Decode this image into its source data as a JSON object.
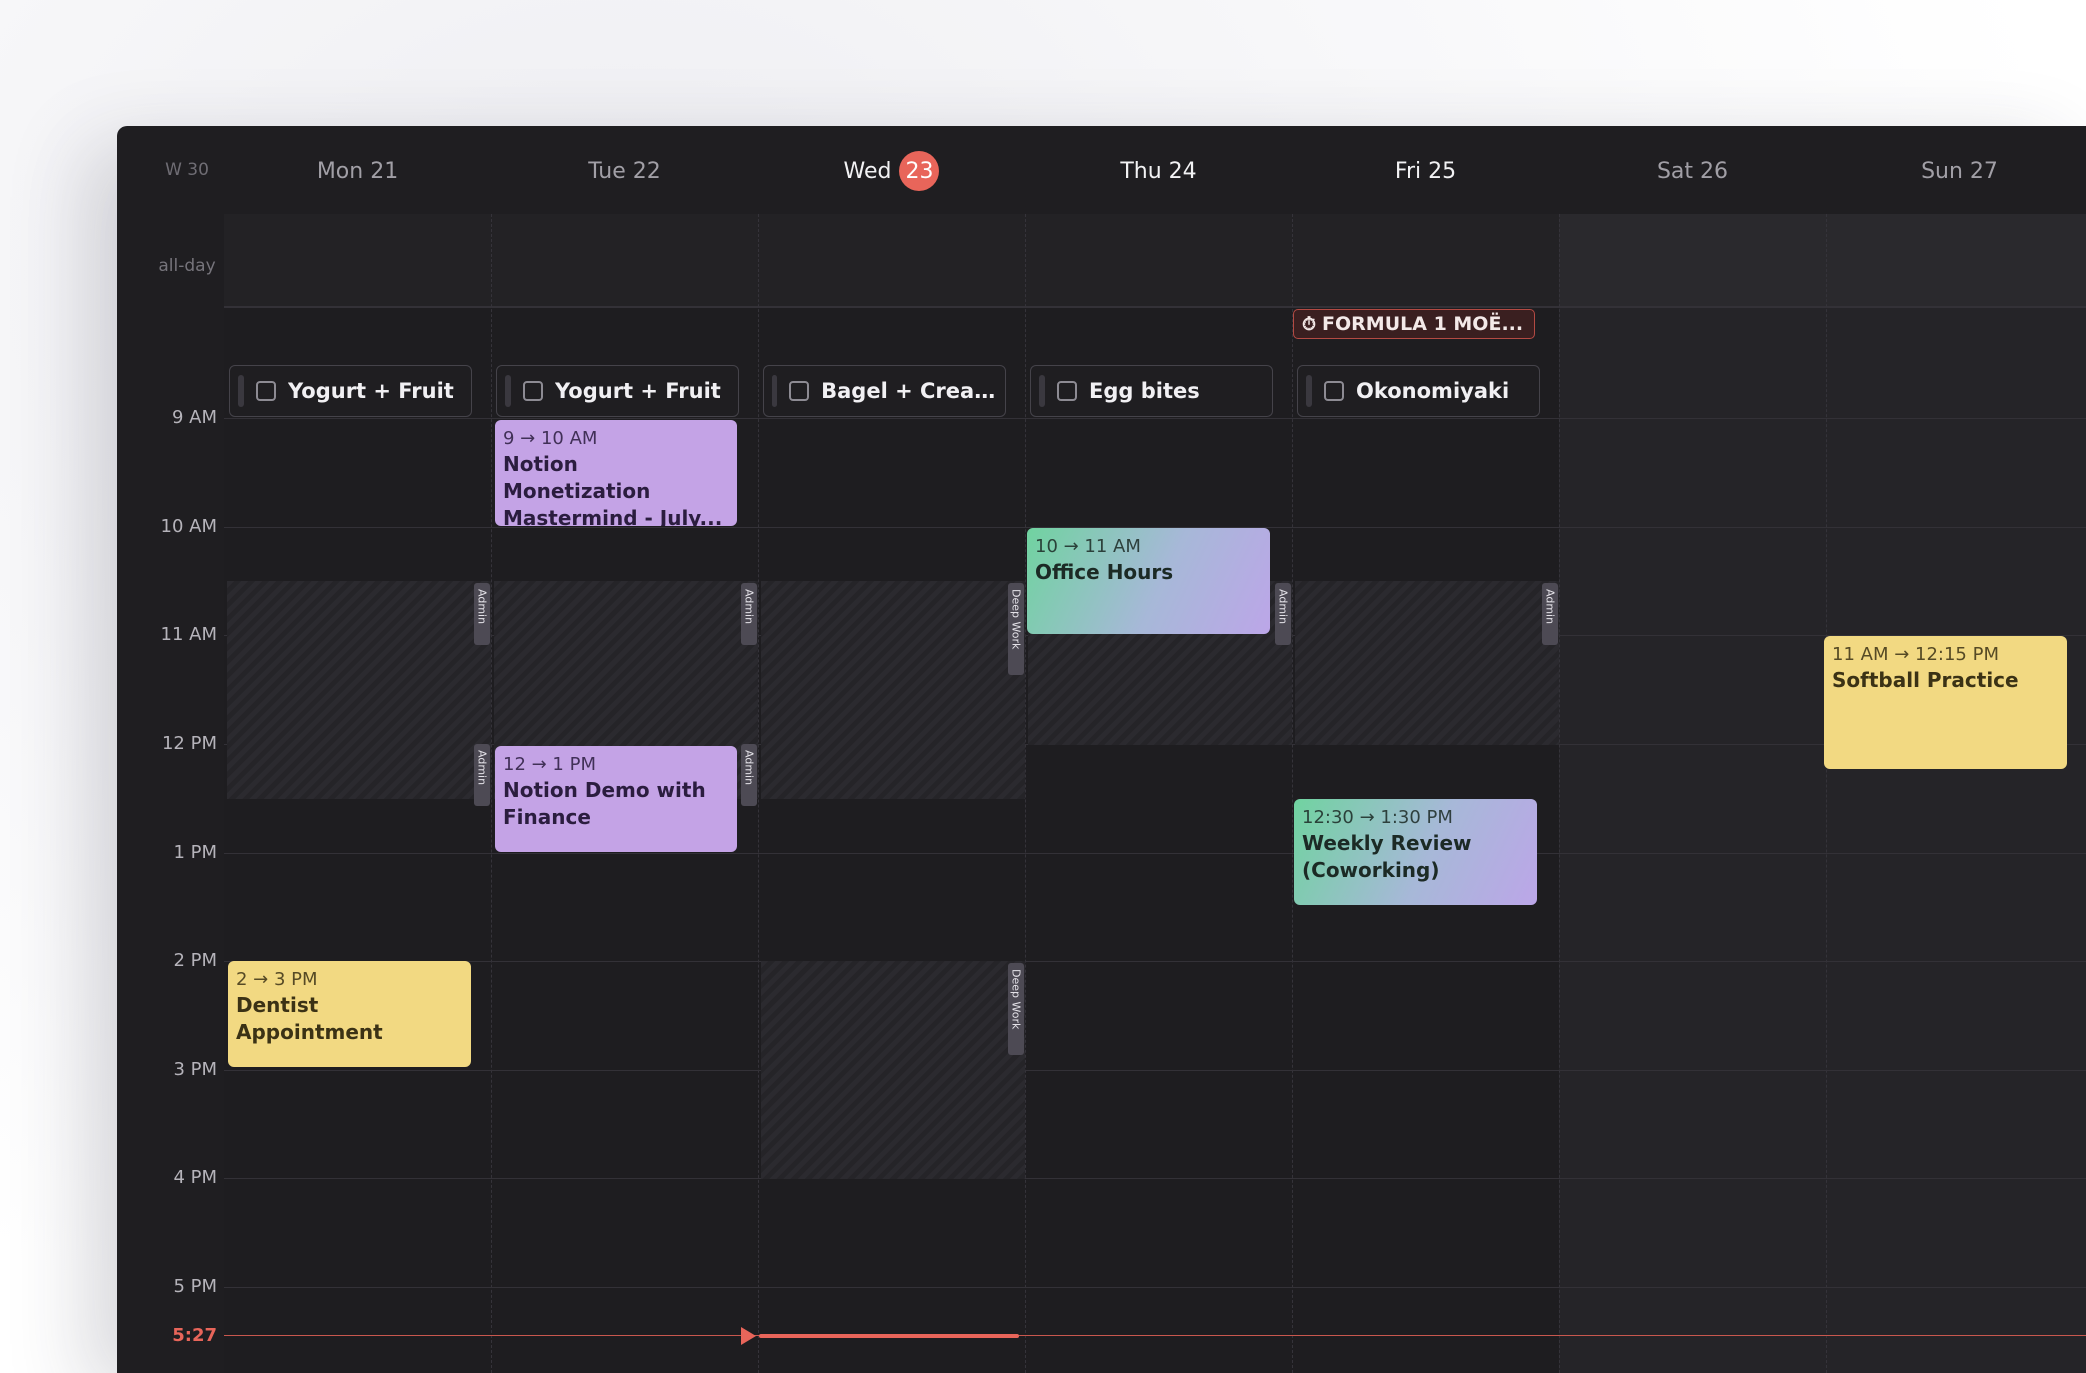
{
  "header": {
    "week_label": "W 30",
    "days": [
      {
        "label": "Mon 21"
      },
      {
        "label": "Tue 22"
      },
      {
        "label": "Wed",
        "today_number": "23"
      },
      {
        "label": "Thu 24"
      },
      {
        "label": "Fri 25"
      },
      {
        "label": "Sat 26"
      },
      {
        "label": "Sun 27"
      }
    ]
  },
  "all_day_label": "all-day",
  "time_labels": [
    "9 AM",
    "10 AM",
    "11 AM",
    "12 PM",
    "1 PM",
    "2 PM",
    "3 PM",
    "4 PM",
    "5 PM"
  ],
  "current_time": "5:27",
  "all_day_events": [
    {
      "day": "Fri 25",
      "icon": "stopwatch-icon",
      "title": "FORMULA 1 MOË..."
    }
  ],
  "todos": [
    {
      "day": "Mon 21",
      "title": "Yogurt + Fruit"
    },
    {
      "day": "Tue 22",
      "title": "Yogurt + Fruit"
    },
    {
      "day": "Wed 23",
      "title": "Bagel + Cream ..."
    },
    {
      "day": "Thu 24",
      "title": "Egg bites"
    },
    {
      "day": "Fri 25",
      "title": "Okonomiyaki"
    }
  ],
  "blocks": [
    {
      "day": "Mon 21",
      "tag": "Admin"
    },
    {
      "day": "Mon 21",
      "tag": "Admin"
    },
    {
      "day": "Tue 22",
      "tag": "Admin"
    },
    {
      "day": "Tue 22",
      "tag": "Admin"
    },
    {
      "day": "Wed 23",
      "tag": "Deep Work"
    },
    {
      "day": "Wed 23",
      "tag": "Deep Work"
    },
    {
      "day": "Thu 24",
      "tag": "Admin"
    },
    {
      "day": "Fri 25",
      "tag": "Admin"
    }
  ],
  "events": [
    {
      "day": "Tue 22",
      "time": "9 → 10 AM",
      "title": "Notion Monetization Mastermind - July...",
      "color": "#c4a3e6"
    },
    {
      "day": "Tue 22",
      "time": "12 → 1 PM",
      "title": "Notion Demo with Finance",
      "color": "#c4a3e6"
    },
    {
      "day": "Thu 24",
      "time": "10 → 11 AM",
      "title": "Office Hours",
      "color": "gradient"
    },
    {
      "day": "Fri 25",
      "time": "12:30 → 1:30 PM",
      "title": "Weekly Review (Coworking)",
      "color": "gradient"
    },
    {
      "day": "Mon 21",
      "time": "2 → 3 PM",
      "title": "Dentist Appointment",
      "color": "#f2d982"
    },
    {
      "day": "Sun 27",
      "time": "11 AM → 12:15 PM",
      "title": "Softball Practice",
      "color": "#f2d982"
    }
  ],
  "colors": {
    "today_accent": "#e8655a",
    "event_purple": "#c4a3e6",
    "event_yellow": "#f2d982",
    "background": "#1f1e21"
  }
}
